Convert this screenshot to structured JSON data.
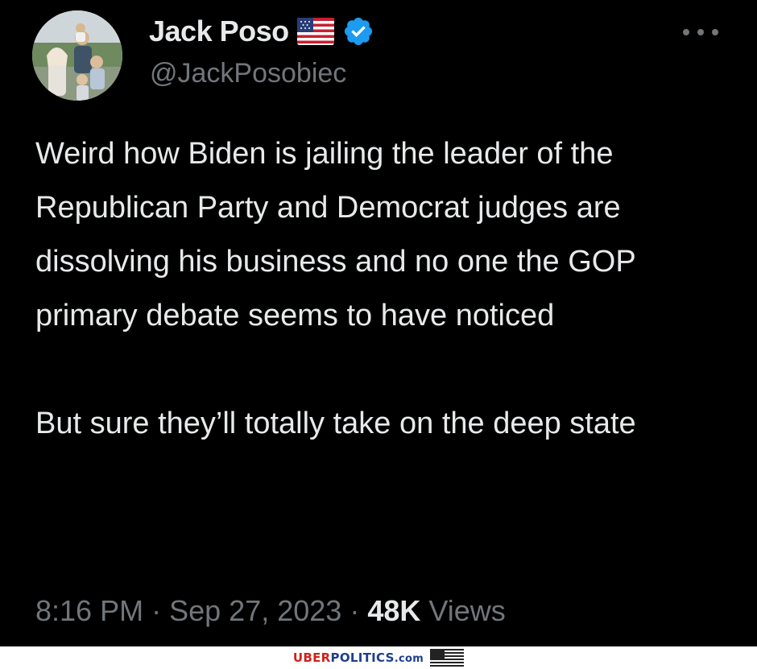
{
  "tweet": {
    "display_name": "Jack Poso",
    "handle": "@JackPosobiec",
    "flag_icon": "us-flag-icon",
    "verified_icon": "verified-badge-icon",
    "more_icon": "more-options-icon",
    "body": [
      "Weird how Biden is jailing the leader of the Republican Party and Democrat judges are dissolving his business and no one the GOP primary debate seems to have noticed",
      "But sure they’ll totally take on the deep state"
    ],
    "time": "8:16 PM",
    "separator": "·",
    "date": "Sep 27, 2023",
    "views_count": "48K",
    "views_label": "Views"
  },
  "watermark": {
    "uber": "UBER",
    "politics": "POLITICS",
    "com": ".com"
  },
  "colors": {
    "background": "#000000",
    "text": "#e7e9ea",
    "secondary_text": "#71767b",
    "verified": "#1d9bf0"
  }
}
